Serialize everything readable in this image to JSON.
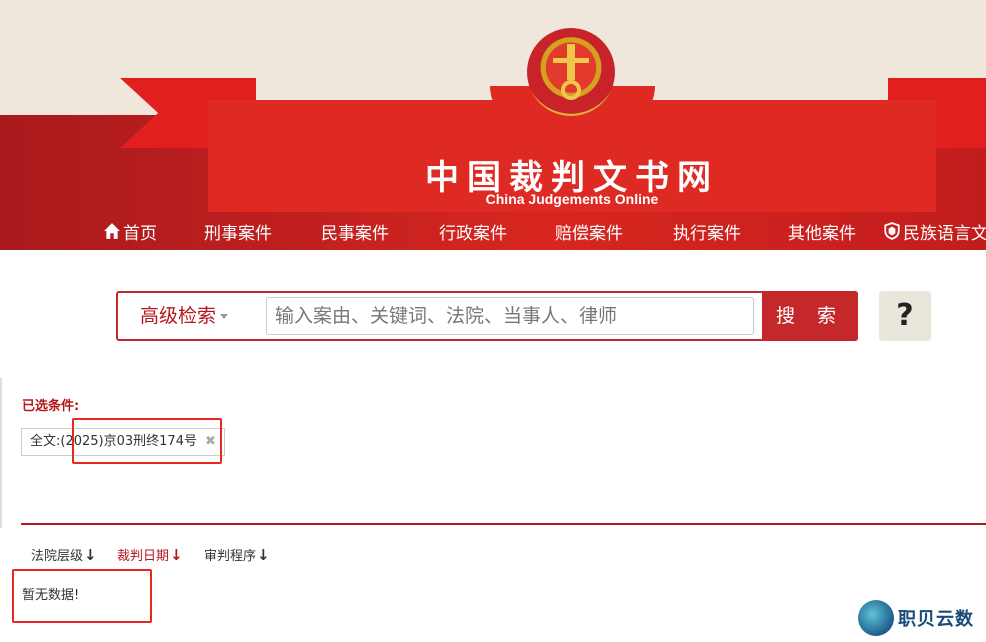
{
  "header": {
    "site_title": "中国裁判文书网",
    "site_subtitle": "China Judgements Online",
    "nav": [
      {
        "label": "首页",
        "icon": "home-icon"
      },
      {
        "label": "刑事案件"
      },
      {
        "label": "民事案件"
      },
      {
        "label": "行政案件"
      },
      {
        "label": "赔偿案件"
      },
      {
        "label": "执行案件"
      },
      {
        "label": "其他案件"
      },
      {
        "label": "民族语言文",
        "icon": "shield-icon"
      }
    ]
  },
  "search": {
    "advanced_label": "高级检索",
    "placeholder": "输入案由、关键词、法院、当事人、律师",
    "button_label": "搜 索",
    "help_label": "?"
  },
  "filters": {
    "selected_label": "已选条件:",
    "chip_prefix": "全文:",
    "chip_value": "(2025)京03刑终174号",
    "chip_close": "✖"
  },
  "sort": [
    {
      "label": "法院层级",
      "arrow": "↓",
      "active": false
    },
    {
      "label": "裁判日期",
      "arrow": "↓",
      "active": true
    },
    {
      "label": "审判程序",
      "arrow": "↓",
      "active": false
    }
  ],
  "results": {
    "empty_text": "暂无数据!"
  },
  "watermark": {
    "text": "职贝云数"
  },
  "colors": {
    "brand_red": "#c5282a",
    "label_red": "#b3181b",
    "highlight_red": "#e8281f"
  }
}
